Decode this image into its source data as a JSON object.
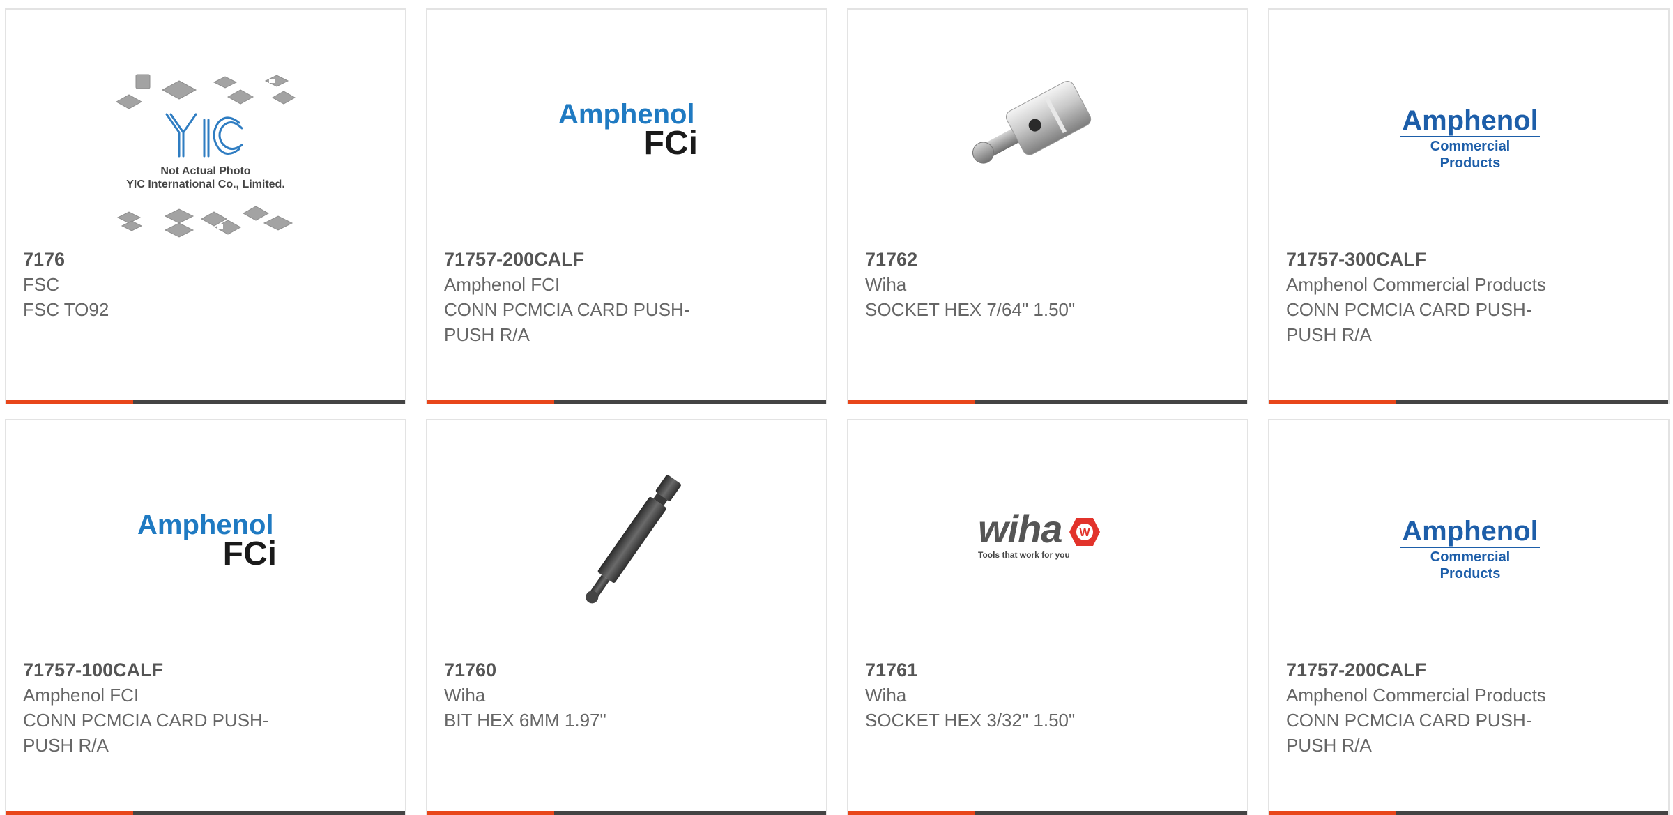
{
  "products": [
    {
      "part_number": "7176",
      "manufacturer": "FSC",
      "description": "FSC TO92",
      "image": "yic-not-actual-photo"
    },
    {
      "part_number": "71757-200CALF",
      "manufacturer": "Amphenol FCI",
      "description": "CONN PCMCIA CARD PUSH-PUSH R/A",
      "image": "amphenol-fci-logo"
    },
    {
      "part_number": "71762",
      "manufacturer": "Wiha",
      "description": "SOCKET HEX 7/64\" 1.50\"",
      "image": "hex-socket-photo"
    },
    {
      "part_number": "71757-300CALF",
      "manufacturer": "Amphenol Commercial Products",
      "description": "CONN PCMCIA CARD PUSH-PUSH R/A",
      "image": "amphenol-commercial-logo"
    },
    {
      "part_number": "71757-100CALF",
      "manufacturer": "Amphenol FCI",
      "description": "CONN PCMCIA CARD PUSH-PUSH R/A",
      "image": "amphenol-fci-logo"
    },
    {
      "part_number": "71760",
      "manufacturer": "Wiha",
      "description": "BIT HEX 6MM 1.97\"",
      "image": "hex-bit-photo"
    },
    {
      "part_number": "71761",
      "manufacturer": "Wiha",
      "description": "SOCKET HEX 3/32\" 1.50\"",
      "image": "wiha-logo"
    },
    {
      "part_number": "71757-200CALF",
      "manufacturer": "Amphenol Commercial Products",
      "description": "CONN PCMCIA CARD PUSH-PUSH R/A",
      "image": "amphenol-commercial-logo"
    }
  ],
  "logos": {
    "yic": {
      "caption_line1": "Not Actual Photo",
      "caption_line2": "YIC International Co., Limited.",
      "mark": "YIC"
    },
    "amphenol_fci": {
      "line1": "Amphenol",
      "line2": "FCi"
    },
    "amphenol_commercial": {
      "line1": "Amphenol",
      "line2": "Commercial Products"
    },
    "wiha": {
      "wordmark": "wiha",
      "badge": "W",
      "tagline": "Tools that work for you"
    }
  },
  "colors": {
    "accent": "#e8461a",
    "bar": "#444444",
    "amphenol_fci_blue": "#1f7ac2",
    "amphenol_cp_blue": "#1d5ea9",
    "wiha_red": "#e2332b"
  }
}
